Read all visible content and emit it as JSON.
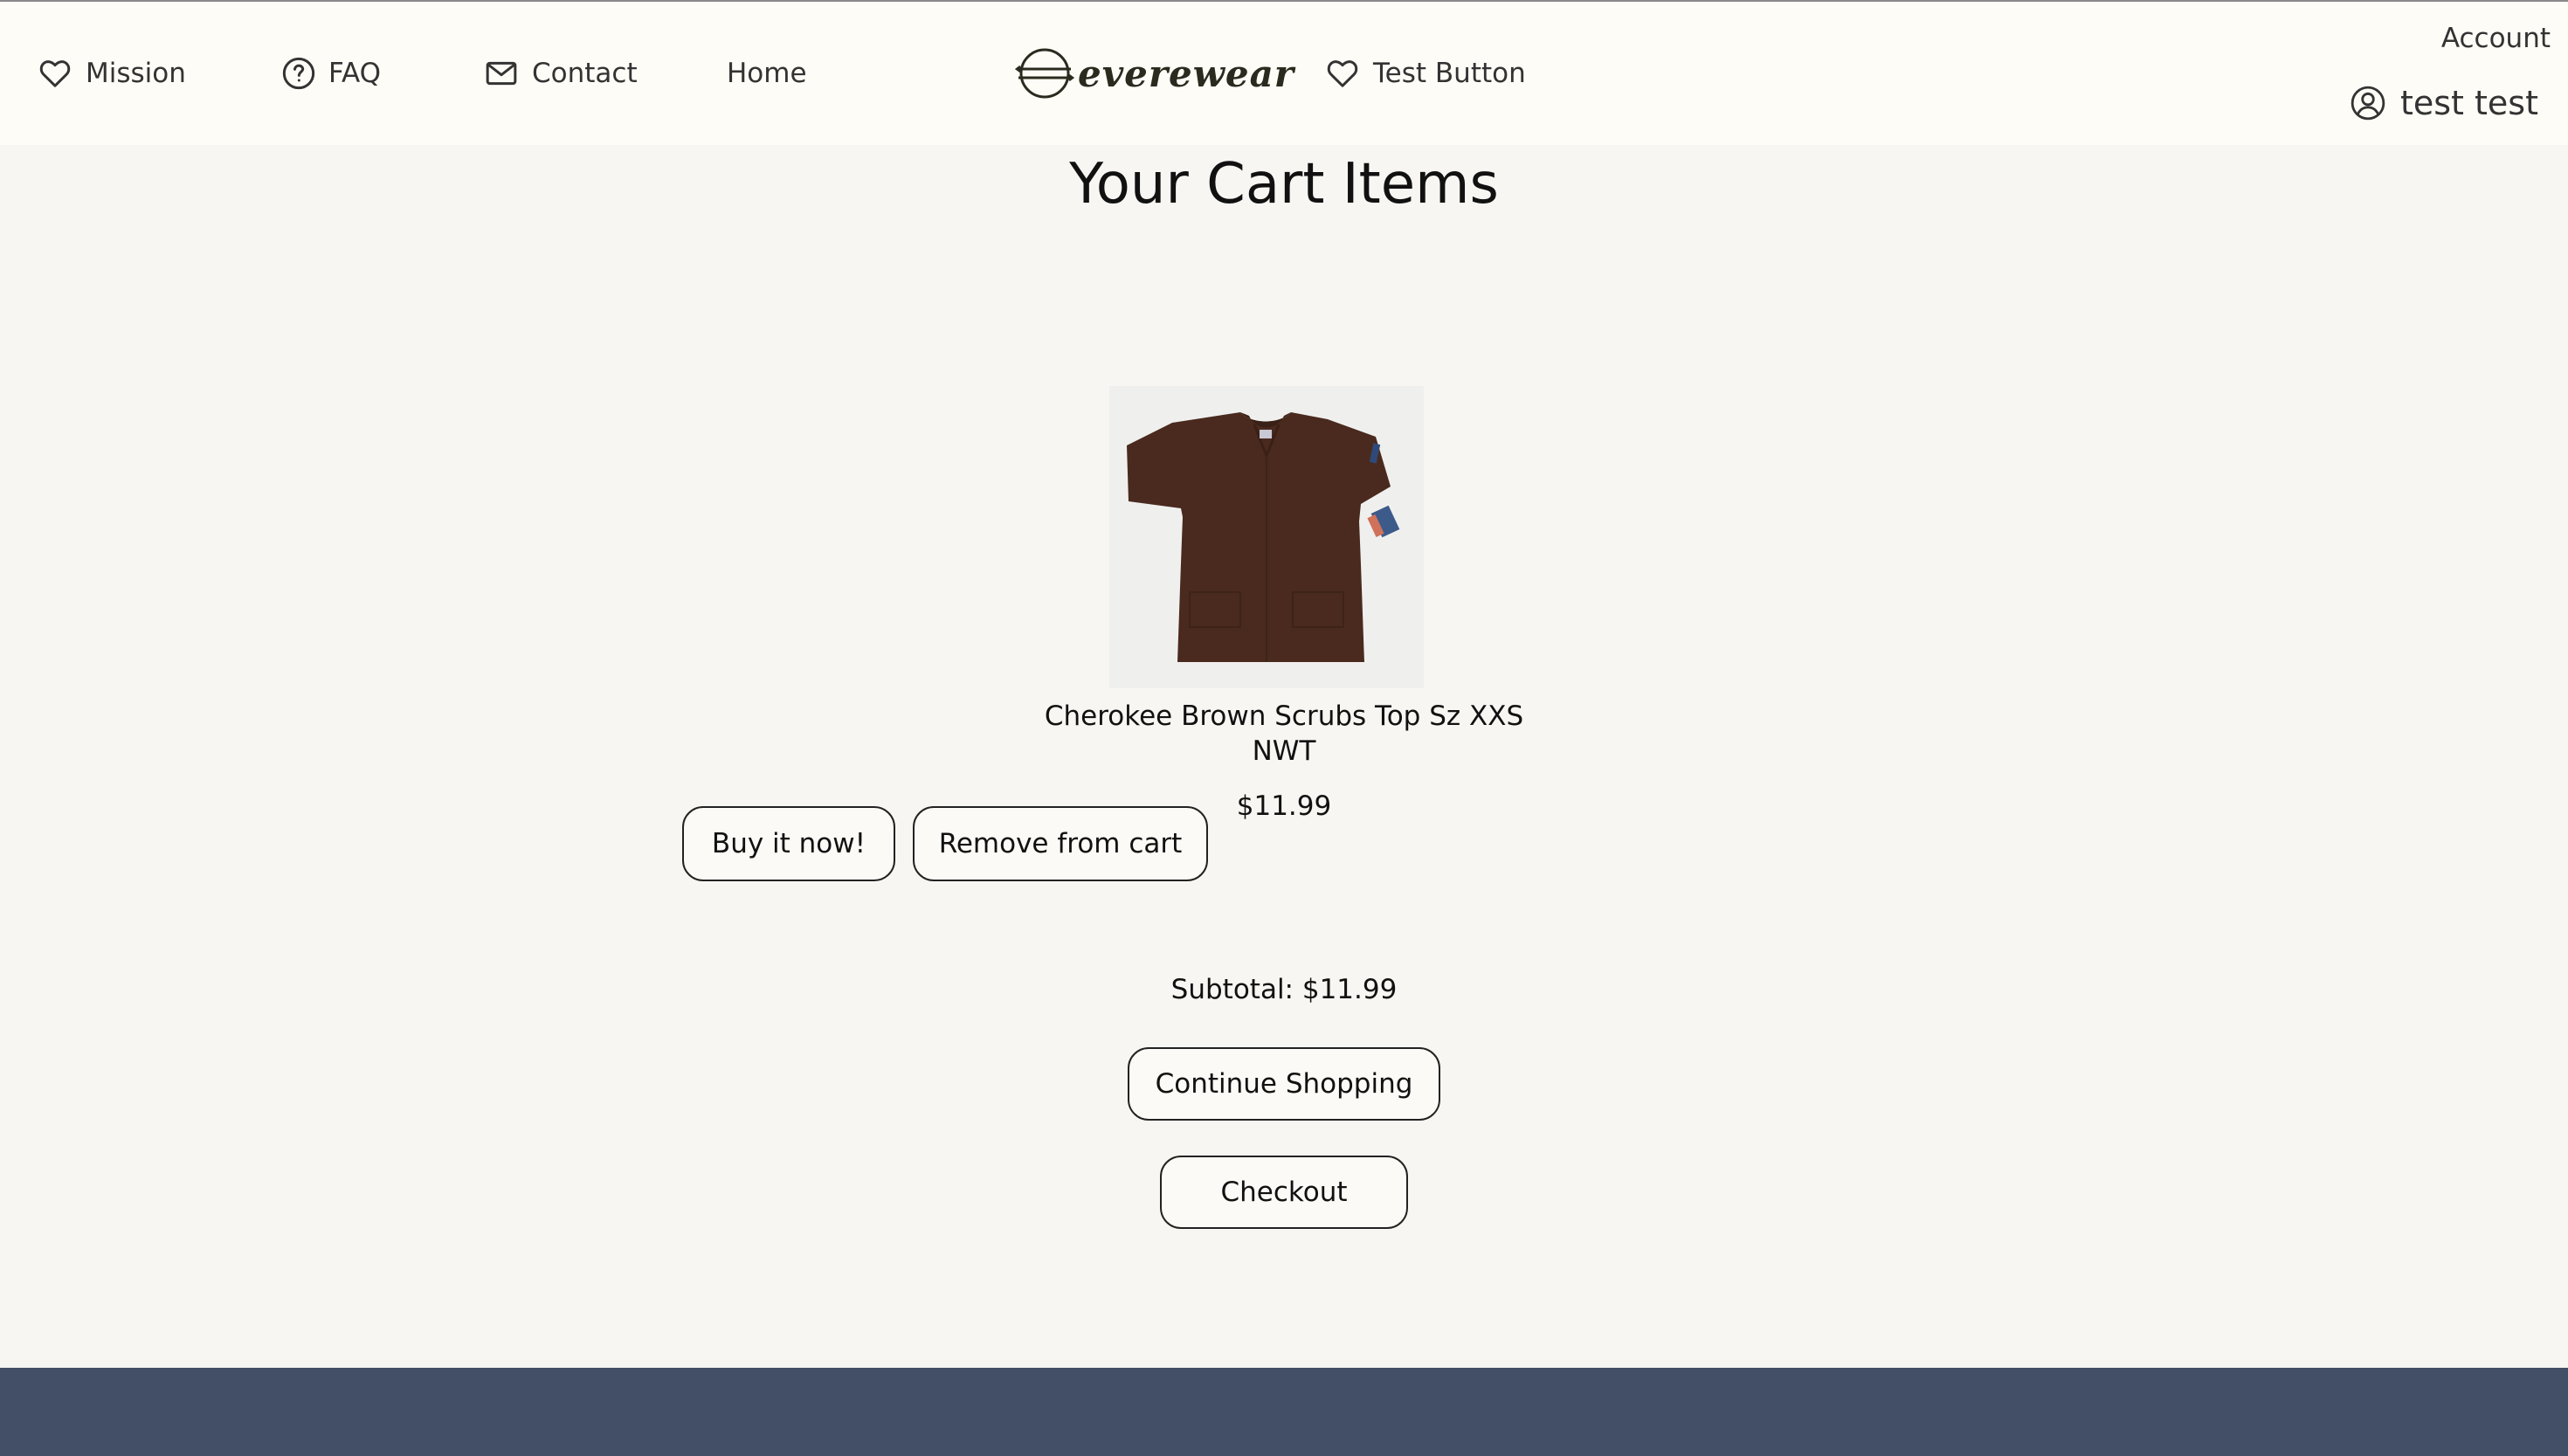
{
  "nav": {
    "mission": "Mission",
    "faq": "FAQ",
    "contact": "Contact",
    "home": "Home",
    "test_button": "Test Button"
  },
  "brand": {
    "name": "everewear"
  },
  "account": {
    "label": "Account",
    "user_name": "test test"
  },
  "page": {
    "title": "Your Cart Items"
  },
  "cart": {
    "items": [
      {
        "name": "Cherokee Brown Scrubs Top Sz XXS NWT",
        "price": "$11.99",
        "buy_label": "Buy it now!",
        "remove_label": "Remove from cart"
      }
    ],
    "subtotal_text": "Subtotal: $11.99",
    "continue_label": "Continue Shopping",
    "checkout_label": "Checkout"
  },
  "colors": {
    "header_bg": "#fefcf7",
    "page_bg": "#f7f6f2",
    "footer_bg": "#434f67",
    "shirt": "#4a2a1e"
  },
  "icons": {
    "mission": "heart-icon",
    "faq": "question-circle-icon",
    "contact": "envelope-icon",
    "test_button": "heart-icon",
    "user": "user-circle-icon"
  }
}
